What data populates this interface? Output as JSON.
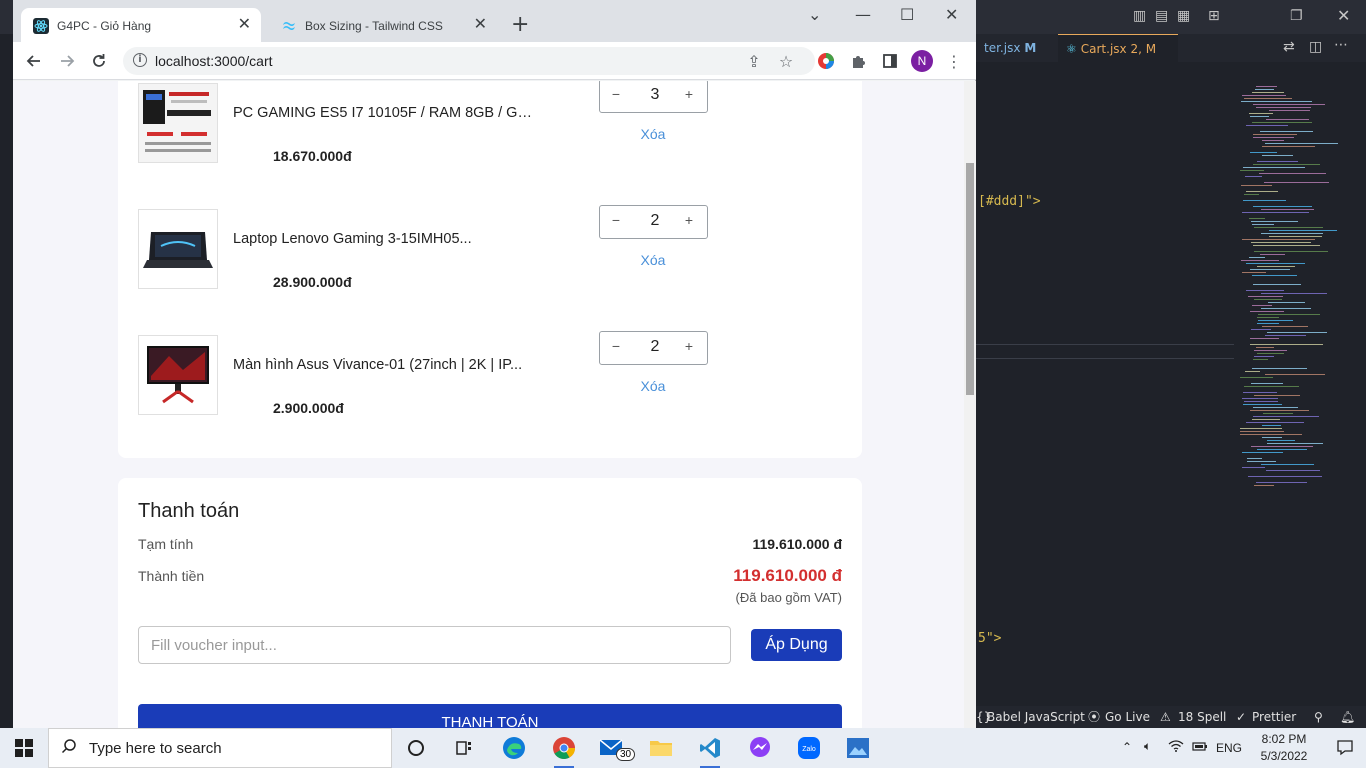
{
  "browser": {
    "tabs": [
      {
        "title": "G4PC - Giỏ Hàng",
        "active": true
      },
      {
        "title": "Box Sizing - Tailwind CSS",
        "active": false
      }
    ],
    "url": "localhost:3000/cart",
    "profile_initial": "N"
  },
  "cart": {
    "items": [
      {
        "name": "PC GAMING ES5 I7 10105F / RAM 8GB / GTX...",
        "price": "18.670.000đ",
        "quantity": "3",
        "remove_label": "Xóa"
      },
      {
        "name": "Laptop Lenovo Gaming 3-15IMH05...",
        "price": "28.900.000đ",
        "quantity": "2",
        "remove_label": "Xóa"
      },
      {
        "name": "Màn hình Asus Vivance-01 (27inch | 2K | IP...",
        "price": "2.900.000đ",
        "quantity": "2",
        "remove_label": "Xóa"
      }
    ],
    "minus_glyph": "−",
    "plus_glyph": "+"
  },
  "payment": {
    "title": "Thanh toán",
    "subtotal_label": "Tạm tính",
    "subtotal_value": "119.610.000 đ",
    "total_label": "Thành tiền",
    "total_value": "119.610.000 đ",
    "vat_note": "(Đã bao gồm VAT)",
    "voucher_placeholder": "Fill voucher input...",
    "apply_label": "Áp Dụng",
    "checkout_label": "THANH TOÁN"
  },
  "vscode": {
    "tabs": [
      {
        "title": "ter.jsx",
        "badge": "M"
      },
      {
        "title": "Cart.jsx 2, M"
      }
    ],
    "code_fragment_1": "[#ddd]\">",
    "code_fragment_2": "5\">",
    "status": {
      "language": "Babel JavaScript",
      "go_live": "Go Live",
      "spell": "18 Spell",
      "prettier": "Prettier"
    }
  },
  "taskbar": {
    "search_placeholder": "Type here to search",
    "mail_badge": "30",
    "lang": "ENG",
    "time": "8:02 PM",
    "date": "5/3/2022"
  },
  "colors": {
    "primary_button": "#1a3cb8",
    "total_red": "#d32f2f",
    "link_blue": "#4a90d9"
  }
}
